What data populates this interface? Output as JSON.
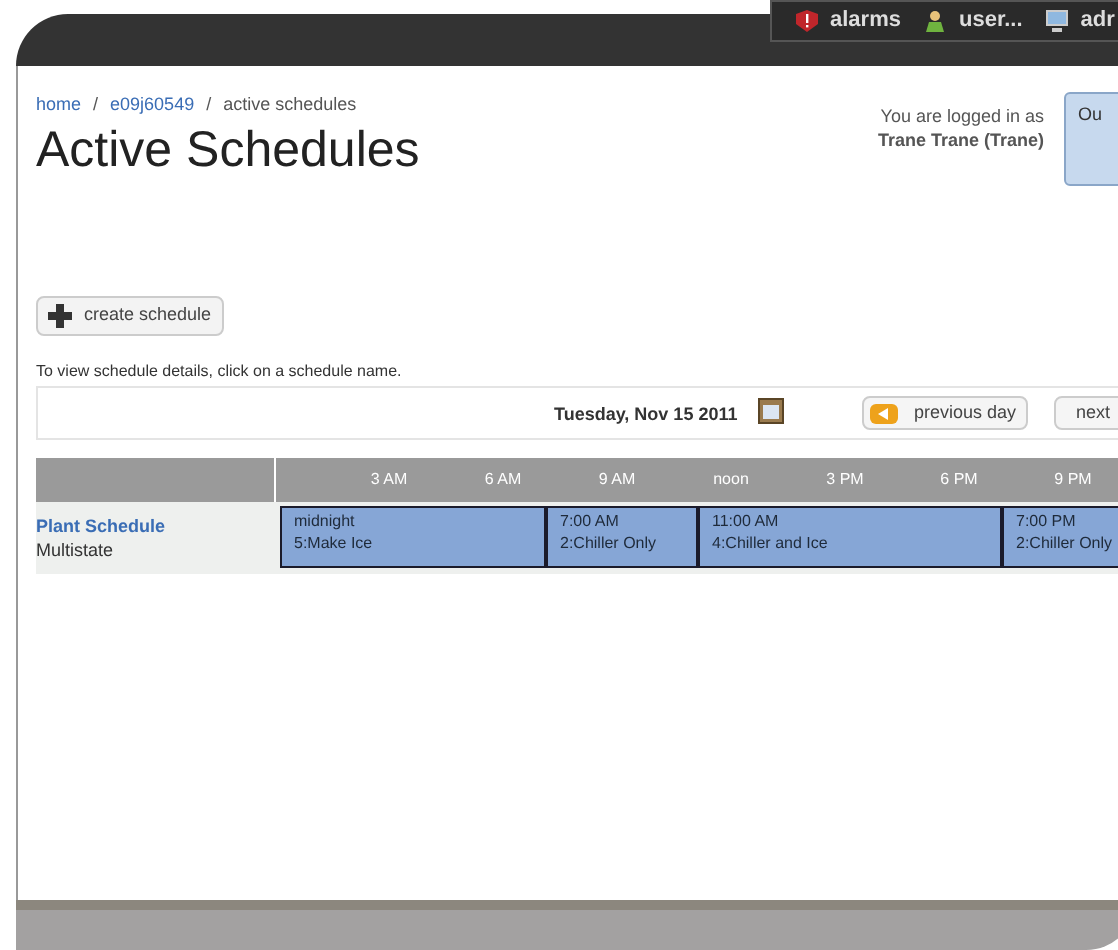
{
  "top_bar": {
    "items": [
      {
        "kind": "alarm",
        "label": "alarms"
      },
      {
        "kind": "user",
        "label": "user..."
      },
      {
        "kind": "computer",
        "label": "adr"
      }
    ]
  },
  "breadcrumb": [
    {
      "kind": "link",
      "text": "home"
    },
    {
      "kind": "separator",
      "text": "/"
    },
    {
      "kind": "link",
      "text": "e09j60549"
    },
    {
      "kind": "separator",
      "text": "/"
    },
    {
      "kind": "current",
      "text": "active schedules"
    }
  ],
  "page_title": "Active Schedules",
  "login": {
    "line_1": "You are logged in as",
    "line_2": "Trane Trane (Trane)"
  },
  "corner_button": {
    "label": "Ou"
  },
  "create_button": {
    "label": "create schedule"
  },
  "hint": "To view schedule details, click on a schedule name.",
  "date_bar": {
    "date": "Tuesday, Nov 15 2011",
    "previous": "previous day",
    "next": "next"
  },
  "timeline": {
    "hours": [
      "3 AM",
      "6 AM",
      "9 AM",
      "noon",
      "3 PM",
      "6 PM",
      "9 PM"
    ],
    "rows": [
      {
        "name": "Plant Schedule",
        "type": "Multistate",
        "blocks": [
          {
            "time": "midnight",
            "state": "5:Make Ice"
          },
          {
            "time": "7:00 AM",
            "state": "2:Chiller Only"
          },
          {
            "time": "11:00 AM",
            "state": "4:Chiller and Ice"
          },
          {
            "time": "7:00 PM",
            "state": "2:Chiller Only"
          }
        ]
      }
    ]
  }
}
